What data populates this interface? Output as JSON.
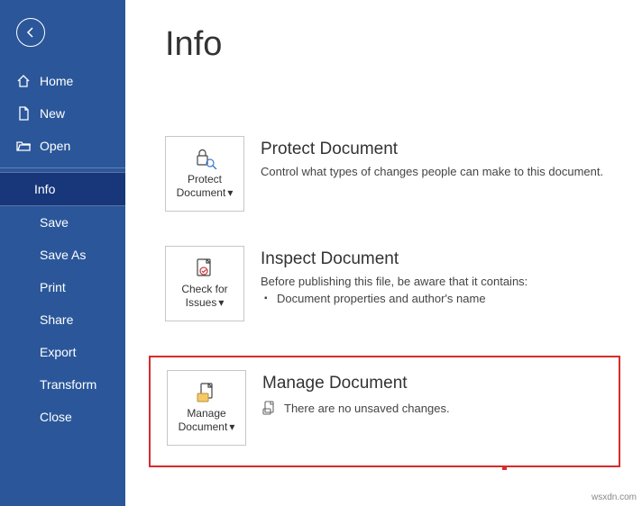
{
  "sidebar": {
    "nav1": [
      {
        "label": "Home",
        "icon": "home"
      },
      {
        "label": "New",
        "icon": "new"
      },
      {
        "label": "Open",
        "icon": "open"
      }
    ],
    "nav2": [
      {
        "label": "Info",
        "selected": true
      },
      {
        "label": "Save"
      },
      {
        "label": "Save As"
      },
      {
        "label": "Print"
      },
      {
        "label": "Share"
      },
      {
        "label": "Export"
      },
      {
        "label": "Transform"
      },
      {
        "label": "Close"
      }
    ]
  },
  "page": {
    "title": "Info"
  },
  "protect": {
    "button_label": "Protect Document",
    "heading": "Protect Document",
    "desc": "Control what types of changes people can make to this document."
  },
  "inspect": {
    "button_label": "Check for Issues",
    "heading": "Inspect Document",
    "desc": "Before publishing this file, be aware that it contains:",
    "item1": "Document properties and author's name"
  },
  "manage": {
    "button_label": "Manage Document",
    "heading": "Manage Document",
    "msg": "There are no unsaved changes."
  },
  "watermark": "wsxdn.com"
}
